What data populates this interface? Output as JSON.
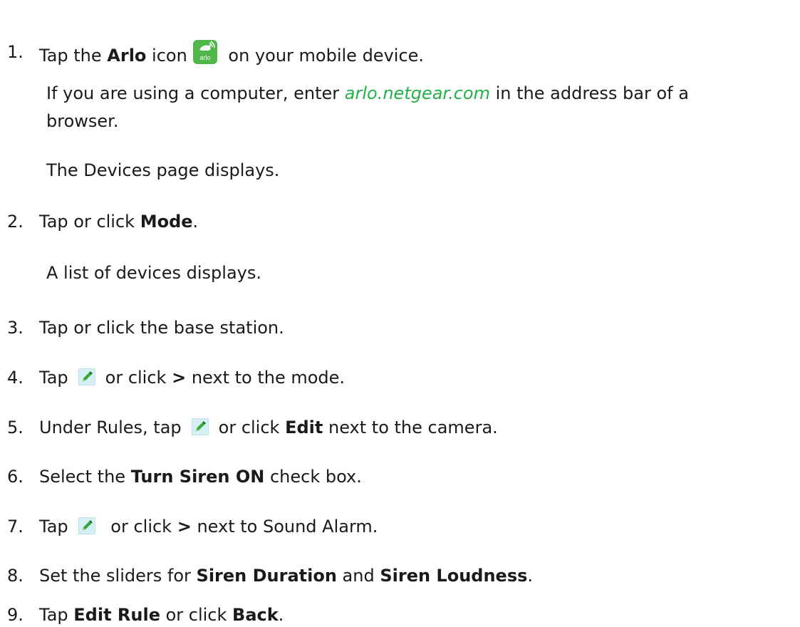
{
  "steps": [
    {
      "num": "1.",
      "pre": "Tap the ",
      "bold": "Arlo",
      "mid": " icon",
      "post": " on your mobile device.",
      "icon_label": "arlo"
    },
    {
      "num": "2.",
      "pre": "Tap or click ",
      "bold": "Mode",
      "post": "."
    },
    {
      "num": "3.",
      "text": "Tap or click the base station."
    },
    {
      "num": "4.",
      "pre": "Tap",
      "mid": "or click ",
      "bold": ">",
      "post": " next to the mode."
    },
    {
      "num": "5.",
      "pre": "Under Rules, tap",
      "mid": "or click ",
      "bold": "Edit",
      "post": " next to the camera."
    },
    {
      "num": "6.",
      "pre": "Select the ",
      "bold": "Turn Siren ON",
      "post": " check box."
    },
    {
      "num": "7.",
      "pre": "Tap",
      "mid": " or click ",
      "bold": ">",
      "post": " next to Sound Alarm."
    },
    {
      "num": "8.",
      "pre": "Set the sliders for ",
      "bold": "Siren Duration",
      "mid": " and ",
      "bold2": "Siren Loudness",
      "post": "."
    },
    {
      "num": "9.",
      "pre": "Tap ",
      "bold": "Edit Rule",
      "mid": " or click ",
      "bold2": "Back",
      "post": "."
    }
  ],
  "notes": {
    "computer_pre": "If you are using a computer, enter ",
    "computer_link": "arlo.netgear.com",
    "computer_post": " in the address bar of a",
    "computer_line2": "browser.",
    "devices_page": "The Devices page displays.",
    "device_list": "A list of devices displays."
  },
  "icons": {
    "app": "arlo-app-icon",
    "edit": "edit-pencil-icon"
  },
  "colors": {
    "link": "#22b04a",
    "arlo_green": "#4fb748",
    "edit_bg": "#d6eff5"
  }
}
